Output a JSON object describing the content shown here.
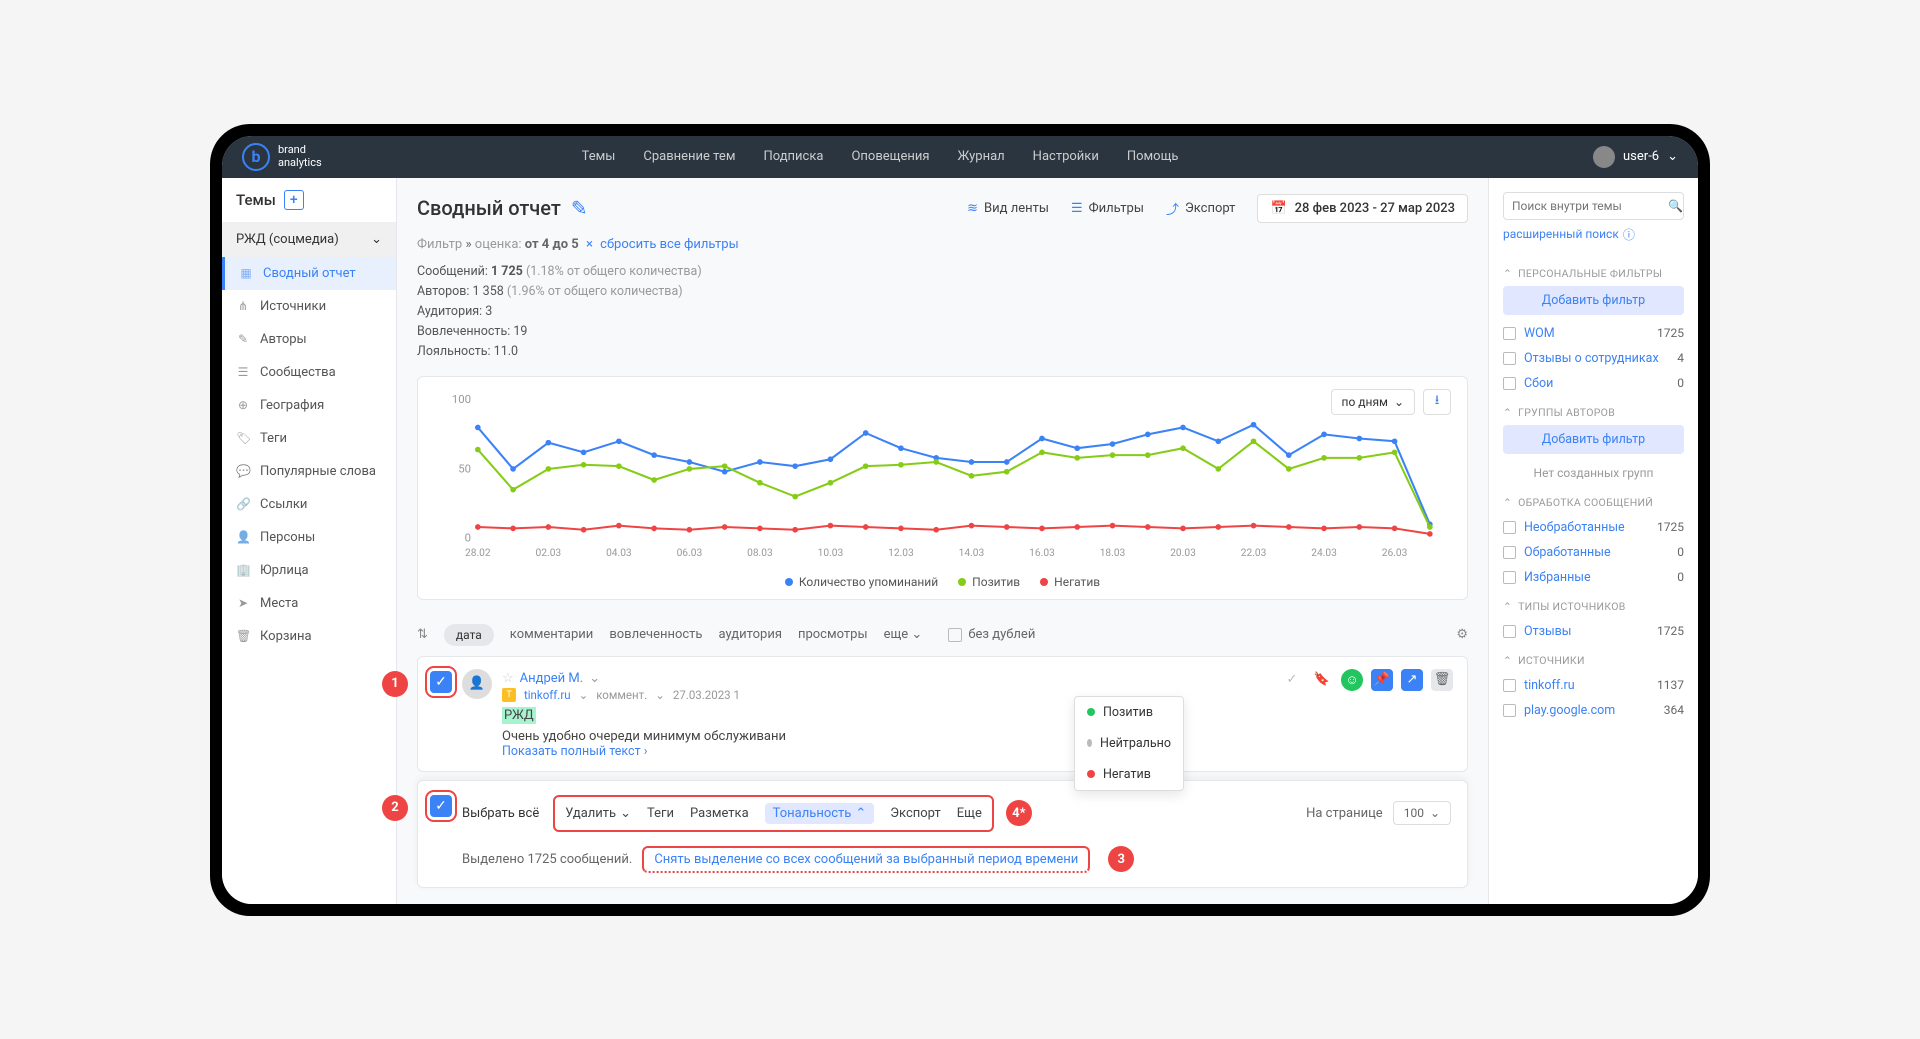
{
  "header": {
    "brand1": "brand",
    "brand2": "analytics",
    "nav": [
      "Темы",
      "Сравнение тем",
      "Подписка",
      "Оповещения",
      "Журнал",
      "Настройки",
      "Помощь"
    ],
    "user": "user-6"
  },
  "sidebar": {
    "title": "Темы",
    "topic": "РЖД (соцмедиа)",
    "items": [
      {
        "label": "Сводный отчет",
        "icon": "▦",
        "active": true
      },
      {
        "label": "Источники",
        "icon": "⋔"
      },
      {
        "label": "Авторы",
        "icon": "✎"
      },
      {
        "label": "Сообщества",
        "icon": "☰"
      },
      {
        "label": "География",
        "icon": "⊕"
      },
      {
        "label": "Теги",
        "icon": "🏷"
      },
      {
        "label": "Популярные слова",
        "icon": "💬"
      },
      {
        "label": "Ссылки",
        "icon": "🔗"
      },
      {
        "label": "Персоны",
        "icon": "👤"
      },
      {
        "label": "Юрлица",
        "icon": "🏢"
      },
      {
        "label": "Места",
        "icon": "➤"
      },
      {
        "label": "Корзина",
        "icon": "🗑"
      }
    ]
  },
  "main": {
    "title": "Сводный отчет",
    "toolbar": {
      "view": "Вид ленты",
      "filters": "Фильтры",
      "export": "Экспорт"
    },
    "date_range": "28 фев 2023 - 27 мар 2023",
    "filter": {
      "prefix": "Фильтр",
      "field": "оценка:",
      "value": "от 4 до 5",
      "reset": "сбросить все фильтры"
    },
    "stats": {
      "messages_label": "Сообщений:",
      "messages_val": "1 725",
      "messages_pct": "(1.18% от общего количества)",
      "authors_label": "Авторов:",
      "authors_val": "1 358",
      "authors_pct": "(1.96% от общего количества)",
      "audience_label": "Аудитория:",
      "audience_val": "3",
      "engagement_label": "Вовлеченность:",
      "engagement_val": "19",
      "loyalty_label": "Лояльность:",
      "loyalty_val": "11.0"
    }
  },
  "chart_data": {
    "type": "line",
    "granularity": "по дням",
    "yticks": [
      0,
      50,
      100
    ],
    "categories": [
      "28.02",
      "02.03",
      "04.03",
      "06.03",
      "08.03",
      "10.03",
      "12.03",
      "14.03",
      "16.03",
      "18.03",
      "20.03",
      "22.03",
      "24.03",
      "26.03"
    ],
    "series": [
      {
        "name": "Количество упоминаний",
        "color": "#3b82f6",
        "values": [
          80,
          50,
          69,
          62,
          70,
          60,
          55,
          48,
          55,
          52,
          57,
          76,
          65,
          58,
          55,
          55,
          72,
          65,
          68,
          75,
          80,
          70,
          82,
          60,
          75,
          72,
          70,
          10
        ]
      },
      {
        "name": "Позитив",
        "color": "#84cc16",
        "values": [
          64,
          35,
          50,
          53,
          52,
          42,
          50,
          52,
          40,
          30,
          40,
          52,
          53,
          55,
          45,
          48,
          62,
          58,
          60,
          60,
          65,
          50,
          70,
          50,
          58,
          58,
          62,
          8
        ]
      },
      {
        "name": "Негатив",
        "color": "#ef4444",
        "values": [
          8,
          7,
          8,
          6,
          9,
          7,
          6,
          8,
          7,
          6,
          9,
          8,
          7,
          6,
          9,
          8,
          7,
          8,
          9,
          8,
          7,
          8,
          9,
          8,
          7,
          8,
          7,
          3
        ]
      }
    ]
  },
  "sort": {
    "pill": "дата",
    "items": [
      "комментарии",
      "вовлеченность",
      "аудитория",
      "просмотры",
      "еще"
    ],
    "nodup": "без дублей"
  },
  "message": {
    "author": "Андрей М.",
    "site": "tinkoff.ru",
    "type": "коммент.",
    "date": "27.03.2023 1",
    "highlight": "РЖД",
    "text": "Очень удобно очереди минимум обслуживани",
    "more": "Показать полный текст ›"
  },
  "tone_popup": {
    "positive": "Позитив",
    "neutral": "Нейтрально",
    "negative": "Негатив"
  },
  "bulk": {
    "select_all": "Выбрать всё",
    "actions": {
      "delete": "Удалить",
      "tags": "Теги",
      "markup": "Разметка",
      "tone": "Тональность",
      "export": "Экспорт",
      "more": "Еще"
    },
    "per_page_label": "На странице",
    "per_page_val": "100",
    "selected": "Выделено 1725 сообщений.",
    "deselect": "Снять выделение со всех сообщений за выбранный период времени"
  },
  "markers": {
    "m1": "1",
    "m2": "2",
    "m3": "3",
    "m4": "4*"
  },
  "right": {
    "search_ph": "Поиск внутри темы",
    "adv": "расширенный поиск",
    "sec_personal": "ПЕРСОНАЛЬНЫЕ ФИЛЬТРЫ",
    "add_filter": "Добавить фильтр",
    "personal": [
      {
        "label": "WOM",
        "count": "1725"
      },
      {
        "label": "Отзывы о сотрудниках",
        "count": "4"
      },
      {
        "label": "Сбои",
        "count": "0"
      }
    ],
    "sec_groups": "ГРУППЫ АВТОРОВ",
    "no_groups": "Нет созданных групп",
    "sec_proc": "ОБРАБОТКА СООБЩЕНИЙ",
    "proc": [
      {
        "label": "Необработанные",
        "count": "1725"
      },
      {
        "label": "Обработанные",
        "count": "0"
      },
      {
        "label": "Избранные",
        "count": "0"
      }
    ],
    "sec_types": "ТИПЫ ИСТОЧНИКОВ",
    "types": [
      {
        "label": "Отзывы",
        "count": "1725"
      }
    ],
    "sec_sources": "ИСТОЧНИКИ",
    "sources": [
      {
        "label": "tinkoff.ru",
        "count": "1137"
      },
      {
        "label": "play.google.com",
        "count": "364"
      }
    ]
  }
}
